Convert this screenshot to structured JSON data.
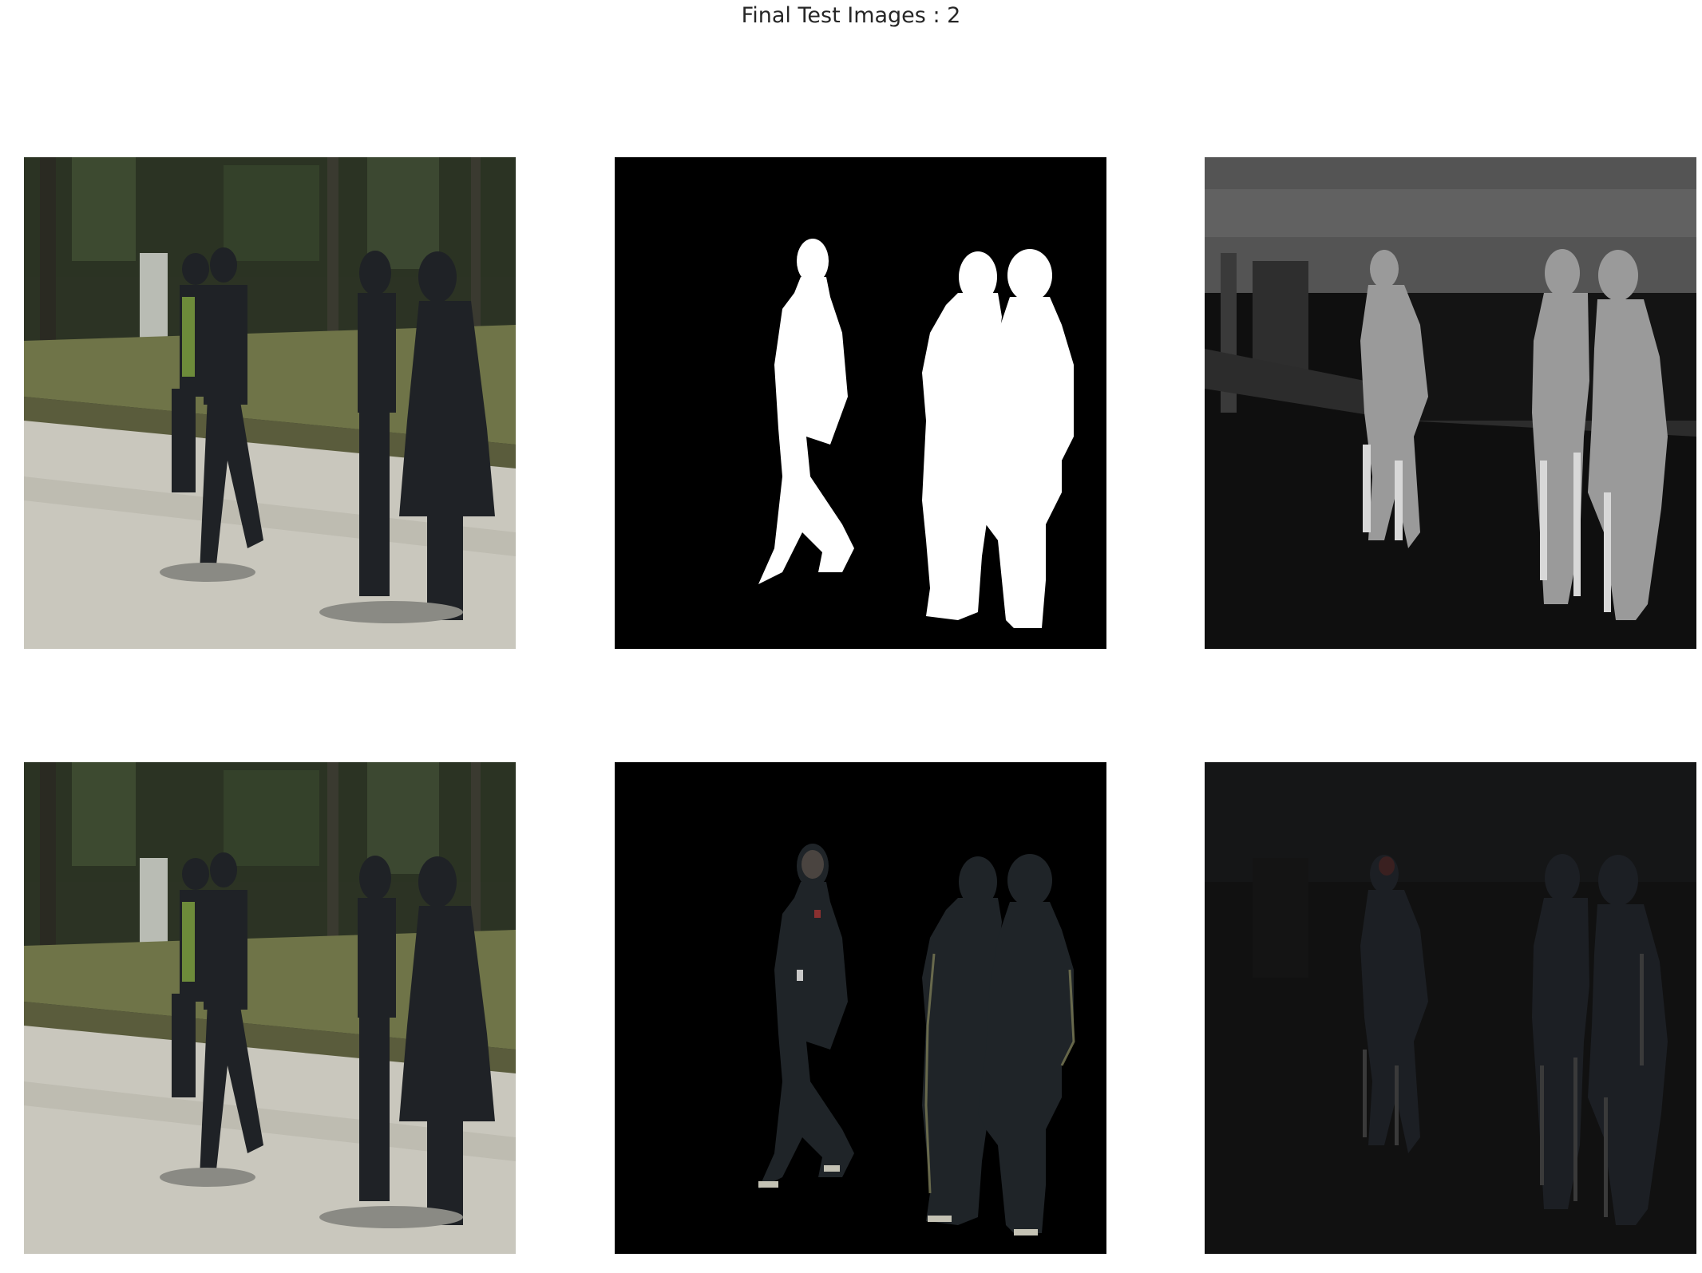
{
  "figure": {
    "title": "Final Test Images : 2"
  },
  "colors": {
    "background": "#ffffff",
    "title_text": "#262626",
    "mask_foreground": "#ffffff",
    "mask_background": "#000000",
    "grass": "#6f7448",
    "pavement": "#c9c7bd",
    "trees": "#2b3323",
    "clothing_dark": "#1f2226",
    "jacket_green": "#6d8b3a"
  }
}
